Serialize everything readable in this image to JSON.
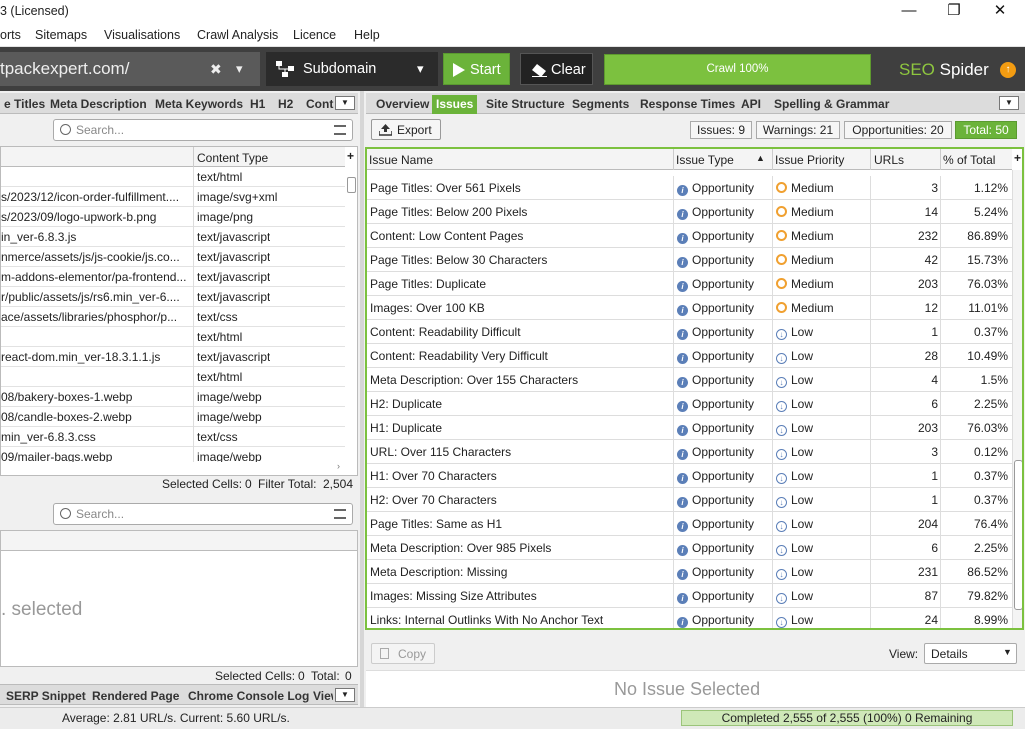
{
  "window": {
    "title": "3 (Licensed)",
    "min": "—",
    "max": "❐",
    "close": "✕"
  },
  "menu": [
    "orts",
    "Sitemaps",
    "Visualisations",
    "Crawl Analysis",
    "Licence",
    "Help"
  ],
  "toolbar": {
    "url": "tpackexpert.com/",
    "url_clear": "✖",
    "url_drop": "▾",
    "mode": "Subdomain",
    "mode_drop": "▾",
    "start": "Start",
    "clear": "Clear",
    "progress": "Crawl 100%",
    "brand_a": "SEO",
    "brand_b": " Spider",
    "alert": "↑"
  },
  "left": {
    "tabs": [
      "e Titles",
      "Meta Description",
      "Meta Keywords",
      "H1",
      "H2",
      "Cont"
    ],
    "search_placeholder": "Search...",
    "content_type_header": "Content Type",
    "plus": "+",
    "rows": [
      {
        "url": "",
        "type": "text/html"
      },
      {
        "url": "s/2023/12/icon-order-fulfillment....",
        "type": "image/svg+xml"
      },
      {
        "url": "s/2023/09/logo-upwork-b.png",
        "type": "image/png"
      },
      {
        "url": "in_ver-6.8.3.js",
        "type": "text/javascript"
      },
      {
        "url": "nmerce/assets/js/js-cookie/js.co...",
        "type": "text/javascript"
      },
      {
        "url": "m-addons-elementor/pa-frontend...",
        "type": "text/javascript"
      },
      {
        "url": "r/public/assets/js/rs6.min_ver-6....",
        "type": "text/javascript"
      },
      {
        "url": "ace/assets/libraries/phosphor/p...",
        "type": "text/css"
      },
      {
        "url": "",
        "type": "text/html"
      },
      {
        "url": "react-dom.min_ver-18.3.1.1.js",
        "type": "text/javascript"
      },
      {
        "url": "",
        "type": "text/html"
      },
      {
        "url": "08/bakery-boxes-1.webp",
        "type": "image/webp"
      },
      {
        "url": "08/candle-boxes-2.webp",
        "type": "image/webp"
      },
      {
        "url": "min_ver-6.8.3.css",
        "type": "text/css"
      },
      {
        "url": "09/mailer-bags.webp",
        "type": "image/webp"
      }
    ],
    "selected_label": "Selected Cells:",
    "selected_value": "0",
    "filter_label": "Filter Total:",
    "filter_value": "2,504",
    "search2_placeholder": "Search...",
    "empty_text": ". selected",
    "selected2_label": "Selected Cells:",
    "selected2_value": "0",
    "total2_label": "Total:",
    "total2_value": "0",
    "bottom_tabs": [
      "SERP Snippet",
      "Rendered Page",
      "Chrome Console Log",
      "View"
    ]
  },
  "right": {
    "tabs": [
      "Overview",
      "Issues",
      "Site Structure",
      "Segments",
      "Response Times",
      "API",
      "Spelling & Grammar"
    ],
    "export": "Export",
    "pills": {
      "issues": "Issues: 9",
      "warnings": "Warnings: 21",
      "opportunities": "Opportunities: 20",
      "total": "Total: 50"
    },
    "headers": {
      "name": "Issue Name",
      "type": "Issue Type",
      "sort": "▲",
      "priority": "Issue Priority",
      "urls": "URLs",
      "pct": "% of Total",
      "plus": "+"
    },
    "rows": [
      {
        "name": "Page Titles: Over 561 Pixels",
        "type": "Opportunity",
        "priority": "Medium",
        "level": "m",
        "urls": "3",
        "pct": "1.12%"
      },
      {
        "name": "Page Titles: Below 200 Pixels",
        "type": "Opportunity",
        "priority": "Medium",
        "level": "m",
        "urls": "14",
        "pct": "5.24%"
      },
      {
        "name": "Content: Low Content Pages",
        "type": "Opportunity",
        "priority": "Medium",
        "level": "m",
        "urls": "232",
        "pct": "86.89%"
      },
      {
        "name": "Page Titles: Below 30 Characters",
        "type": "Opportunity",
        "priority": "Medium",
        "level": "m",
        "urls": "42",
        "pct": "15.73%"
      },
      {
        "name": "Page Titles: Duplicate",
        "type": "Opportunity",
        "priority": "Medium",
        "level": "m",
        "urls": "203",
        "pct": "76.03%"
      },
      {
        "name": "Images: Over 100 KB",
        "type": "Opportunity",
        "priority": "Medium",
        "level": "m",
        "urls": "12",
        "pct": "11.01%"
      },
      {
        "name": "Content: Readability Difficult",
        "type": "Opportunity",
        "priority": "Low",
        "level": "l",
        "urls": "1",
        "pct": "0.37%"
      },
      {
        "name": "Content: Readability Very Difficult",
        "type": "Opportunity",
        "priority": "Low",
        "level": "l",
        "urls": "28",
        "pct": "10.49%"
      },
      {
        "name": "Meta Description: Over 155 Characters",
        "type": "Opportunity",
        "priority": "Low",
        "level": "l",
        "urls": "4",
        "pct": "1.5%"
      },
      {
        "name": "H2: Duplicate",
        "type": "Opportunity",
        "priority": "Low",
        "level": "l",
        "urls": "6",
        "pct": "2.25%"
      },
      {
        "name": "H1: Duplicate",
        "type": "Opportunity",
        "priority": "Low",
        "level": "l",
        "urls": "203",
        "pct": "76.03%"
      },
      {
        "name": "URL: Over 115 Characters",
        "type": "Opportunity",
        "priority": "Low",
        "level": "l",
        "urls": "3",
        "pct": "0.12%"
      },
      {
        "name": "H1: Over 70 Characters",
        "type": "Opportunity",
        "priority": "Low",
        "level": "l",
        "urls": "1",
        "pct": "0.37%"
      },
      {
        "name": "H2: Over 70 Characters",
        "type": "Opportunity",
        "priority": "Low",
        "level": "l",
        "urls": "1",
        "pct": "0.37%"
      },
      {
        "name": "Page Titles: Same as H1",
        "type": "Opportunity",
        "priority": "Low",
        "level": "l",
        "urls": "204",
        "pct": "76.4%"
      },
      {
        "name": "Meta Description: Over 985 Pixels",
        "type": "Opportunity",
        "priority": "Low",
        "level": "l",
        "urls": "6",
        "pct": "2.25%"
      },
      {
        "name": "Meta Description: Missing",
        "type": "Opportunity",
        "priority": "Low",
        "level": "l",
        "urls": "231",
        "pct": "86.52%"
      },
      {
        "name": "Images: Missing Size Attributes",
        "type": "Opportunity",
        "priority": "Low",
        "level": "l",
        "urls": "87",
        "pct": "79.82%"
      },
      {
        "name": "Links: Internal Outlinks With No Anchor Text",
        "type": "Opportunity",
        "priority": "Low",
        "level": "l",
        "urls": "24",
        "pct": "8.99%"
      }
    ],
    "copy": "Copy",
    "view_label": "View:",
    "view_value": "Details",
    "no_issue": "No Issue Selected"
  },
  "status": {
    "speed": "Average: 2.81 URL/s. Current: 5.60 URL/s.",
    "completed": "Completed 2,555 of 2,555 (100%) 0 Remaining"
  }
}
